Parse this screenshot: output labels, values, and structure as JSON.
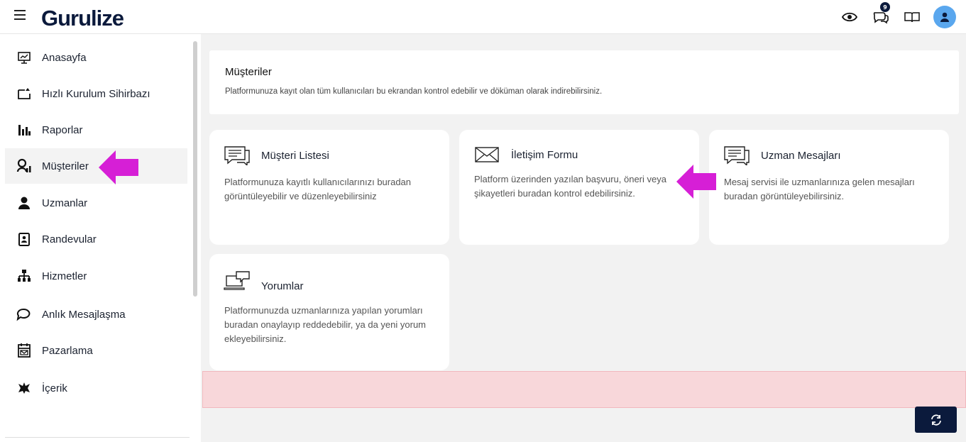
{
  "app": {
    "logo_text": "Gurulize"
  },
  "topbar": {
    "notification_count": "9"
  },
  "sidebar": {
    "items": [
      {
        "label": "Anasayfa",
        "icon": "dashboard-icon"
      },
      {
        "label": "Hızlı Kurulum Sihirbazı",
        "icon": "wizard-icon"
      },
      {
        "label": "Raporlar",
        "icon": "bar-chart-icon"
      },
      {
        "label": "Müşteriler",
        "icon": "customers-icon",
        "active": true
      },
      {
        "label": "Uzmanlar",
        "icon": "user-icon"
      },
      {
        "label": "Randevular",
        "icon": "calendar-badge-icon"
      },
      {
        "label": "Hizmetler",
        "icon": "hierarchy-icon"
      },
      {
        "label": "Anlık Mesajlaşma",
        "icon": "chat-icon"
      },
      {
        "label": "Pazarlama",
        "icon": "marketing-icon"
      },
      {
        "label": "İçerik",
        "icon": "content-icon"
      }
    ]
  },
  "header": {
    "title": "Müşteriler",
    "description": "Platformunuza kayıt olan tüm kullanıcıları bu ekrandan kontrol edebilir ve döküman olarak indirebilirsiniz."
  },
  "cards": [
    {
      "title": "Müşteri Listesi",
      "description": "Platformunuza kayıtlı kullanıcılarınızı buradan görüntüleyebilir ve düzenleyebilirsiniz",
      "icon": "list-chat-icon"
    },
    {
      "title": "İletişim Formu",
      "description": "Platform üzerinden yazılan başvuru, öneri veya şikayetleri buradan kontrol edebilirsiniz.",
      "icon": "envelope-icon"
    },
    {
      "title": "Uzman Mesajları",
      "description": "Mesaj servisi ile uzmanlarınıza gelen mesajları buradan görüntüleyebilirsiniz.",
      "icon": "list-chat-icon"
    },
    {
      "title": "Yorumlar",
      "description": "Platformunuzda uzmanlarınıza yapılan yorumları buradan onaylayıp reddedebilir, ya da yeni yorum ekleyebilirsiniz.",
      "icon": "laptop-chat-icon"
    }
  ],
  "colors": {
    "brand": "#0b1a3c",
    "annotation_arrow": "#d61fd6",
    "error_bg": "#f8d7da",
    "avatar": "#5aa7ee"
  }
}
